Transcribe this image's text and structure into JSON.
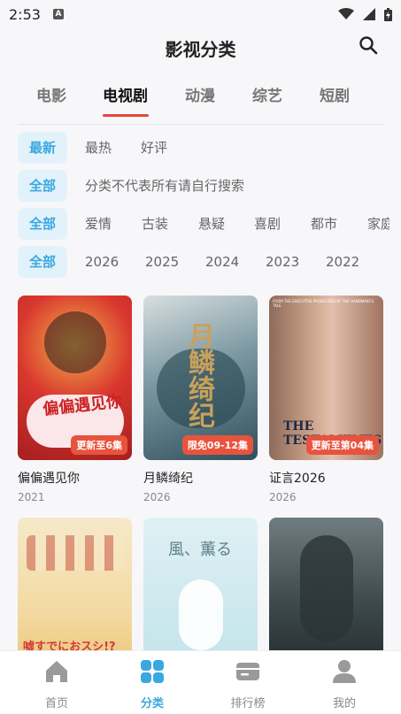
{
  "status_bar": {
    "time": "2:53",
    "notification_icon": "A"
  },
  "header": {
    "title": "影视分类"
  },
  "tabs": [
    {
      "label": "电影"
    },
    {
      "label": "电视剧",
      "active": true
    },
    {
      "label": "动漫"
    },
    {
      "label": "综艺"
    },
    {
      "label": "短剧"
    }
  ],
  "filters": {
    "sort": [
      "最新",
      "最热",
      "好评"
    ],
    "notice": {
      "all": "全部",
      "text": "分类不代表所有请自行搜索"
    },
    "genre": [
      "全部",
      "爱情",
      "古装",
      "悬疑",
      "喜剧",
      "都市",
      "家庭"
    ],
    "year": [
      "全部",
      "2026",
      "2025",
      "2024",
      "2023",
      "2022"
    ]
  },
  "cards": [
    {
      "title": "偏偏遇见你",
      "year": "2021",
      "badge": "更新至6集",
      "poster_text": "偏偏遇见你"
    },
    {
      "title": "月鳞绮纪",
      "year": "2026",
      "badge": "限免09-12集",
      "poster_text": "月鳞绮纪"
    },
    {
      "title": "证言2026",
      "year": "2026",
      "badge": "更新至第04集",
      "poster_text": "THE TESTAMENTS",
      "poster_top": "FROM THE EXECUTIVE PRODUCERS OF THE HANDMAID'S TALE"
    },
    {
      "title": "",
      "year": "",
      "poster_text": "嘘すでにおスシ!?"
    },
    {
      "title": "",
      "year": "",
      "poster_text": "風、薫る"
    },
    {
      "title": "",
      "year": "",
      "poster_text": ""
    }
  ],
  "bottom_nav": [
    {
      "label": "首页",
      "icon": "home-icon"
    },
    {
      "label": "分类",
      "icon": "category-icon",
      "active": true
    },
    {
      "label": "排行榜",
      "icon": "ranking-icon"
    },
    {
      "label": "我的",
      "icon": "profile-icon"
    }
  ],
  "colors": {
    "accent": "#3aa8e0",
    "tab_underline": "#e8453c",
    "badge": "#e8533e"
  }
}
